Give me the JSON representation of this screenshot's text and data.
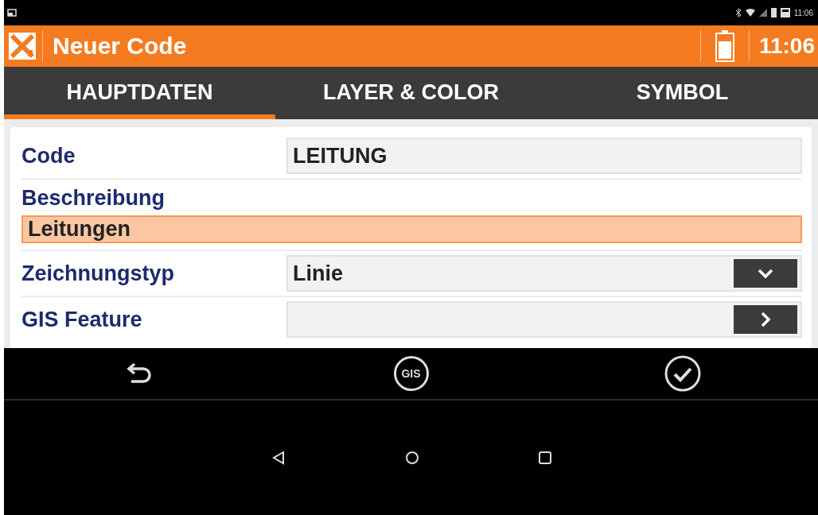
{
  "status_bar": {
    "time": "11:06"
  },
  "app_bar": {
    "title": "Neuer Code",
    "clock": "11:06"
  },
  "tabs": [
    {
      "label": "HAUPTDATEN",
      "selected": true
    },
    {
      "label": "LAYER & COLOR",
      "selected": false
    },
    {
      "label": "SYMBOL",
      "selected": false
    }
  ],
  "fields": [
    {
      "kind": "inline",
      "label": "Code",
      "value": "LEITUNG",
      "focused": false
    },
    {
      "kind": "stacked",
      "label": "Beschreibung",
      "value": "Leitungen",
      "focused": true
    },
    {
      "kind": "dropdown",
      "label": "Zeichnungstyp",
      "value": "Linie",
      "focused": false
    },
    {
      "kind": "link",
      "label": "GIS Feature",
      "focused": false
    }
  ],
  "action_bar": {
    "gis_label": "GIS"
  }
}
